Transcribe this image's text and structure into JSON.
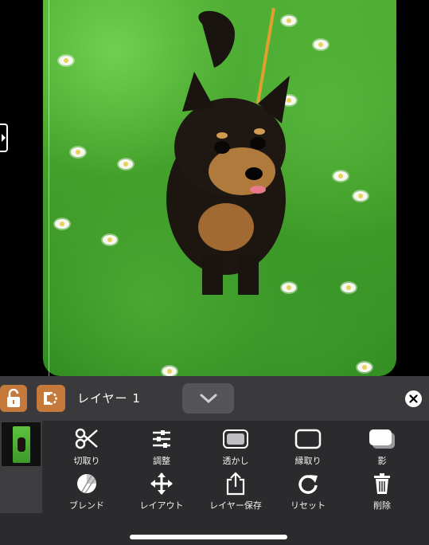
{
  "layer": {
    "name": "レイヤー 1"
  },
  "tools_row1": [
    {
      "id": "cut",
      "label": "切取り",
      "icon": "scissors-icon"
    },
    {
      "id": "adjust",
      "label": "調整",
      "icon": "sliders-icon"
    },
    {
      "id": "transparency",
      "label": "透かし",
      "icon": "transparency-icon"
    },
    {
      "id": "border",
      "label": "縁取り",
      "icon": "border-icon"
    },
    {
      "id": "shadow",
      "label": "影",
      "icon": "shadow-icon"
    }
  ],
  "tools_row2": [
    {
      "id": "blend",
      "label": "ブレンド",
      "icon": "blend-icon"
    },
    {
      "id": "layout",
      "label": "レイアウト",
      "icon": "move-arrows-icon"
    },
    {
      "id": "save_layer",
      "label": "レイヤー保存",
      "icon": "share-icon"
    },
    {
      "id": "reset",
      "label": "リセット",
      "icon": "reset-icon"
    },
    {
      "id": "delete",
      "label": "削除",
      "icon": "trash-icon"
    }
  ],
  "colors": {
    "accent": "#c57a3c",
    "panel": "#2b2b2d",
    "bar": "#3a3a3c"
  }
}
